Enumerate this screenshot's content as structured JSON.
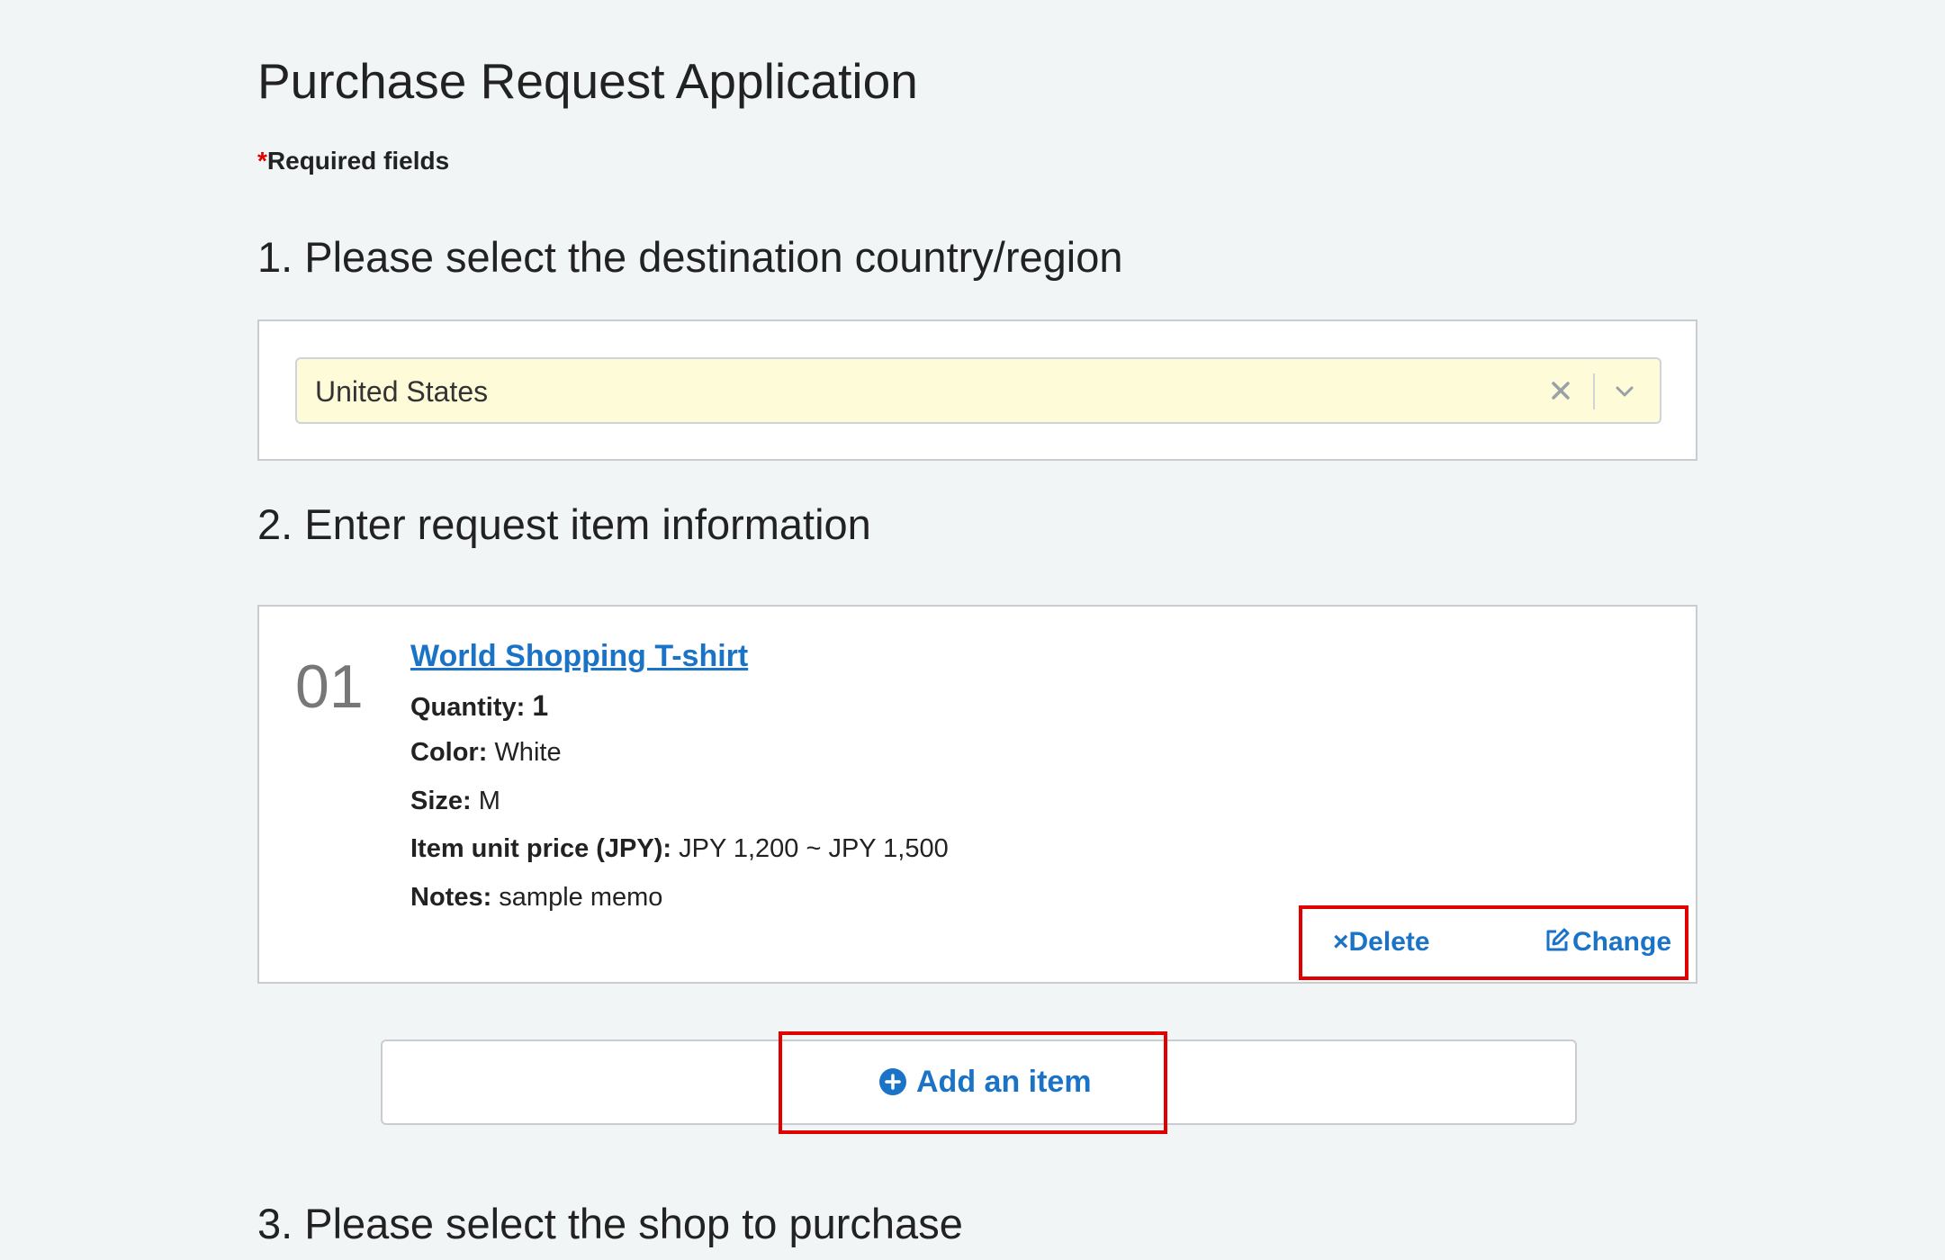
{
  "page": {
    "title": "Purchase Request Application",
    "required_asterisk": "*",
    "required_note": "Required fields"
  },
  "sections": {
    "destination_heading": "1. Please select the destination country/region",
    "items_heading": "2. Enter request item information",
    "shop_heading": "3. Please select the shop to purchase"
  },
  "country_select": {
    "selected_value": "United States",
    "clear_icon": "close-x-icon",
    "dropdown_icon": "chevron-down-icon",
    "background_color": "#fefbd8"
  },
  "items": [
    {
      "number": "01",
      "name": "World Shopping T-shirt",
      "quantity_label": "Quantity:",
      "quantity_value": "1",
      "color_label": "Color:",
      "color_value": "White",
      "size_label": "Size:",
      "size_value": "M",
      "price_label": "Item unit price (JPY):",
      "price_value": "JPY 1,200 ~ JPY 1,500",
      "notes_label": "Notes:",
      "notes_value": "sample memo",
      "delete_label": "×Delete",
      "change_label": "Change"
    }
  ],
  "add_item": {
    "label": "Add an item",
    "icon": "plus-circle-icon"
  },
  "colors": {
    "link_blue": "#1a73c7",
    "highlight_red": "#e00000",
    "page_background": "#f1f5f5"
  }
}
